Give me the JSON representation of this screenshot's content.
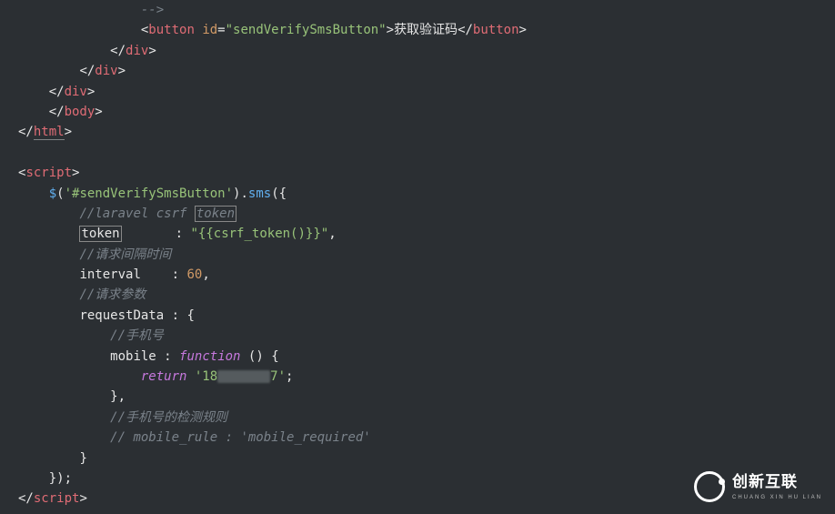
{
  "code": {
    "l1_dashes": "-->",
    "l2_btn_text": "获取验证码",
    "l2_tag": "button",
    "l2_attr": "id",
    "l2_attr_val": "\"sendVerifySmsButton\"",
    "div": "div",
    "body": "body",
    "html": "html",
    "script": "script",
    "jq_sel": "'#sendVerifySmsButton'",
    "sms_fn": "sms",
    "cmt_csrf": "//laravel csrf ",
    "cmt_csrf_token": "token",
    "key_token": "token",
    "val_token": "\"{{csrf_token()}}\"",
    "cmt_interval": "//请求间隔时间",
    "key_interval": "interval",
    "val_interval": "60",
    "cmt_reqdata": "//请求参数",
    "key_reqdata": "requestData",
    "cmt_mobile": "//手机号",
    "key_mobile": "mobile",
    "kw_function": "function",
    "kw_return": "return",
    "mobile_part1": "'18",
    "mobile_part2": "7'",
    "cmt_mobile_rule1": "//手机号的检测规则",
    "cmt_mobile_rule2": "// mobile_rule : 'mobile_required'"
  },
  "logo": {
    "cn": "创新互联",
    "en": "CHUANG XIN HU LIAN"
  }
}
